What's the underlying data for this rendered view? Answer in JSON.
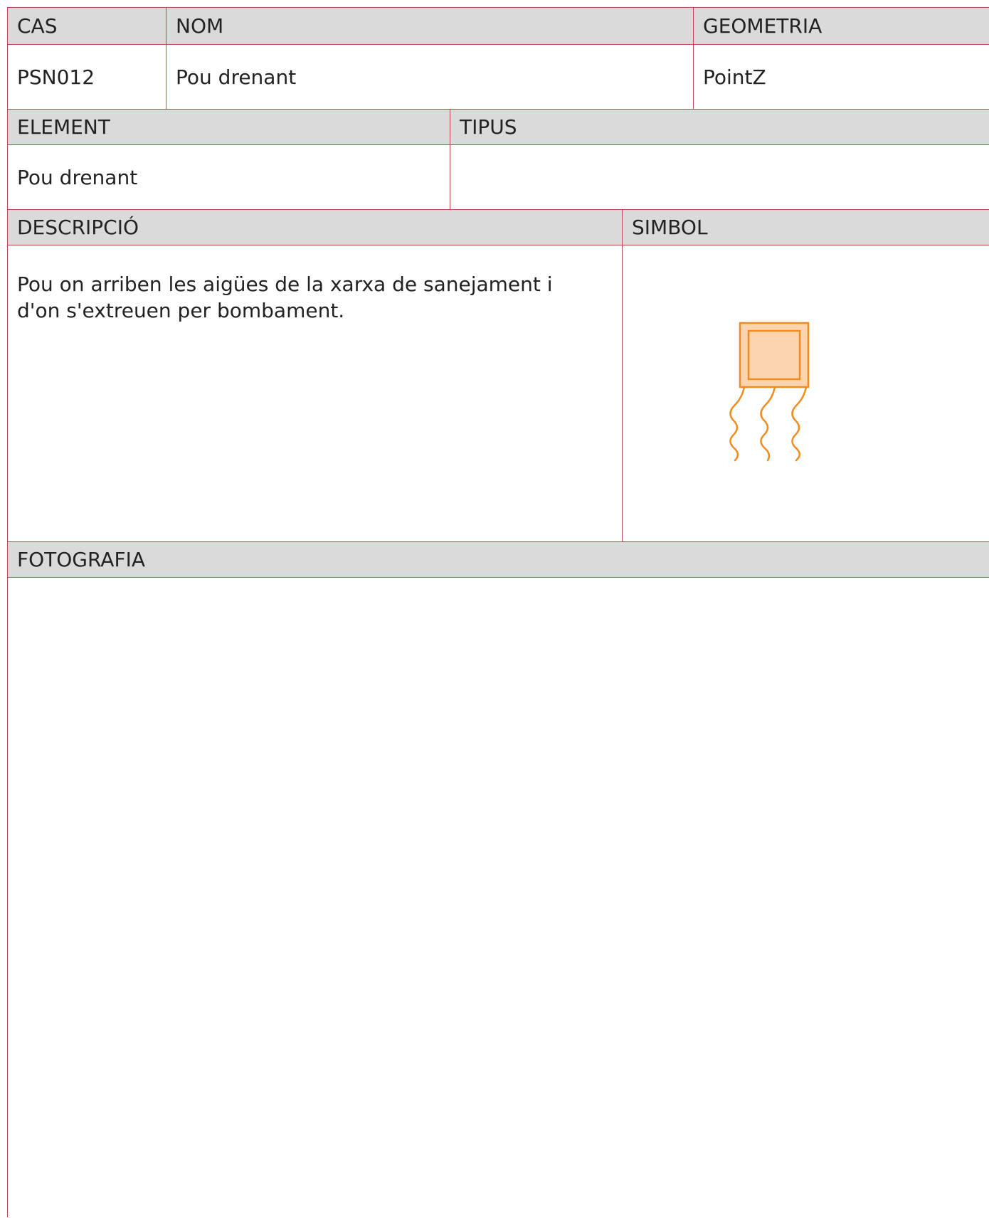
{
  "row1": {
    "cas_label": "CAS",
    "nom_label": "NOM",
    "geometria_label": "GEOMETRIA",
    "cas_value": "PSN012",
    "nom_value": "Pou drenant",
    "geometria_value": "PointZ"
  },
  "row2": {
    "element_label": "ELEMENT",
    "tipus_label": "TIPUS",
    "element_value": "Pou drenant",
    "tipus_value": ""
  },
  "row3": {
    "descripcio_label": "DESCRIPCIÓ",
    "simbol_label": "SIMBOL",
    "descripcio_value": "Pou on arriben les aigües de la xarxa de sanejament i d'on s'extreuen per bombament.",
    "symbol_icon": "drainage-well-icon",
    "symbol_stroke": "#f28c1e",
    "symbol_fill": "#fcd5b0"
  },
  "row4": {
    "fotografia_label": "FOTOGRAFIA"
  },
  "colors": {
    "border": "#c0484c",
    "header_bg": "#dadada"
  }
}
